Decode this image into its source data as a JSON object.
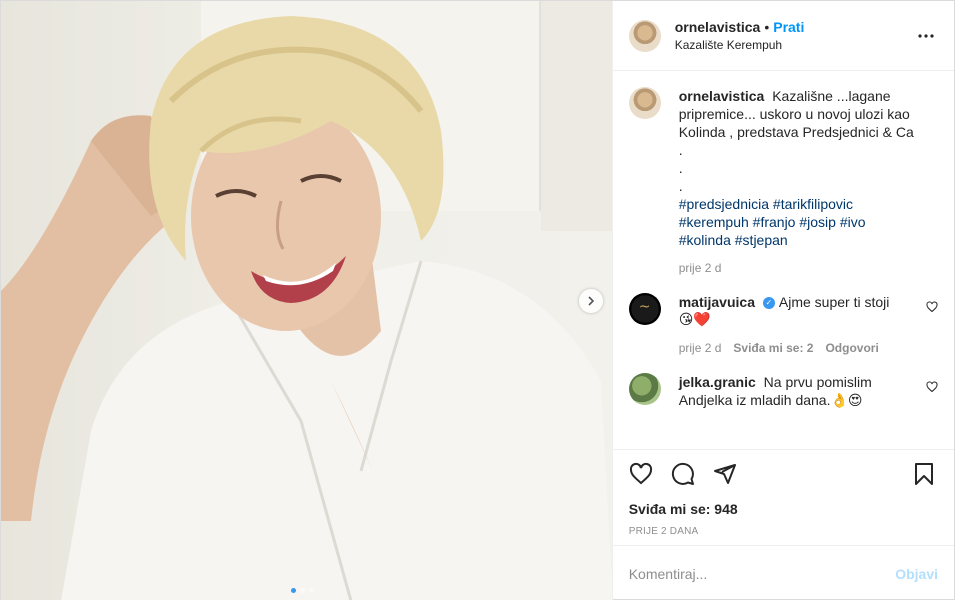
{
  "header": {
    "username": "ornelavistica",
    "separator": "•",
    "follow_label": "Prati",
    "location": "Kazalište Kerempuh"
  },
  "caption": {
    "username": "ornelavistica",
    "text": "Kazališne ...lagane pripremice... uskoro u novoj ulozi kao Kolinda , predstava Predsjednici & Ca",
    "dots": [
      ".",
      ".",
      "."
    ],
    "hashtags": [
      "#predsjednicia",
      "#tarikfilipovic",
      "#kerempuh",
      "#franjo",
      "#josip",
      "#ivo",
      "#kolinda",
      "#stjepan"
    ],
    "time": "prije 2 d"
  },
  "comments": [
    {
      "username": "matijavuica",
      "verified": true,
      "text": "Ajme super ti stoji",
      "emoji": "😘❤️",
      "time": "prije 2 d",
      "likes": "Sviđa mi se: 2",
      "reply_label": "Odgovori"
    },
    {
      "username": "jelka.granic",
      "verified": false,
      "text": "Na prvu pomislim Andjelka iz mladih dana.",
      "emoji": "👌😍"
    }
  ],
  "actions": {
    "like_icon": "heart-icon",
    "comment_icon": "comment-icon",
    "share_icon": "share-icon",
    "save_icon": "bookmark-icon"
  },
  "likes_text": "Sviđa mi se: 948",
  "post_time": "PRIJE 2 DANA",
  "add_comment": {
    "placeholder": "Komentiraj...",
    "post_label": "Objavi"
  },
  "carousel": {
    "total_slides": 3,
    "active_slide": 1
  },
  "colors": {
    "link_blue": "#0095f6",
    "hashtag": "#00376b",
    "muted": "#8e8e8e",
    "post_disabled": "#b2dffc"
  }
}
